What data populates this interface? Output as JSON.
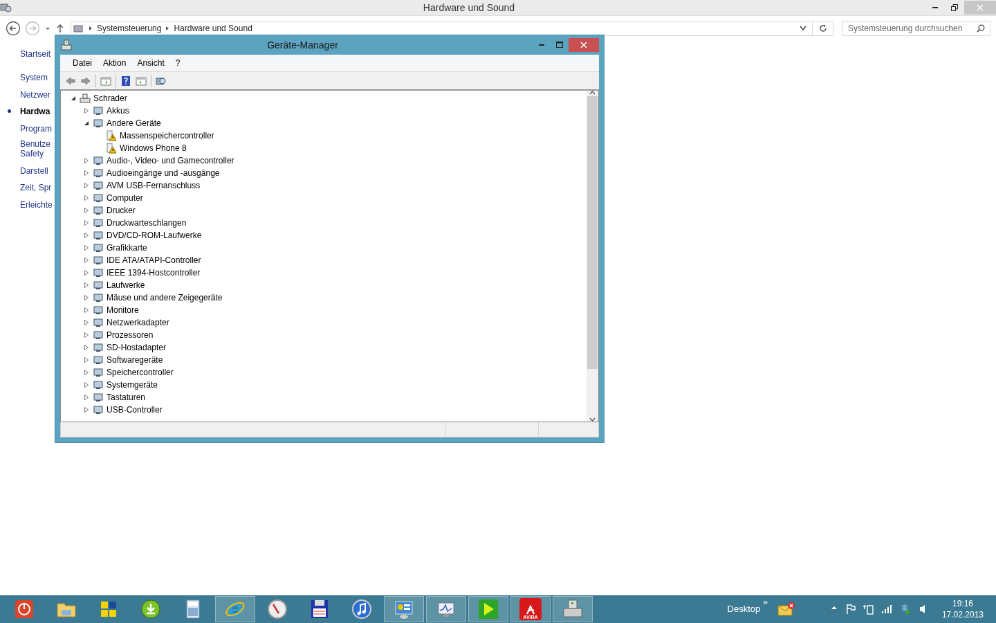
{
  "window": {
    "title": "Hardware und Sound"
  },
  "address": {
    "crumbs": [
      "Systemsteuerung",
      "Hardware und Sound"
    ]
  },
  "search": {
    "placeholder": "Systemsteuerung durchsuchen"
  },
  "sidebar": {
    "items": [
      {
        "lines": [
          "Startseit"
        ],
        "selected": false
      },
      {
        "lines": [
          "System"
        ],
        "selected": false
      },
      {
        "lines": [
          "Netzwer"
        ],
        "selected": false
      },
      {
        "lines": [
          "Hardwa"
        ],
        "selected": true
      },
      {
        "lines": [
          "Program"
        ],
        "selected": false
      },
      {
        "lines": [
          "Benutze",
          "Safety"
        ],
        "selected": false
      },
      {
        "lines": [
          "Darstell"
        ],
        "selected": false
      },
      {
        "lines": [
          "Zeit, Spr"
        ],
        "selected": false
      },
      {
        "lines": [
          "Erleichte"
        ],
        "selected": false
      }
    ]
  },
  "dialog": {
    "title": "Geräte-Manager",
    "menu": [
      "Datei",
      "Aktion",
      "Ansicht",
      "?"
    ],
    "tree": [
      {
        "label": "Schrader",
        "expanded": true,
        "children": [
          {
            "label": "Akkus",
            "expanded": false
          },
          {
            "label": "Andere Geräte",
            "expanded": true,
            "children": [
              {
                "label": "Massenspeichercontroller",
                "warning": true
              },
              {
                "label": "Windows Phone 8",
                "warning": true
              }
            ]
          },
          {
            "label": "Audio-, Video- und Gamecontroller",
            "expanded": false
          },
          {
            "label": "Audioeingänge und -ausgänge",
            "expanded": false
          },
          {
            "label": "AVM USB-Fernanschluss",
            "expanded": false
          },
          {
            "label": "Computer",
            "expanded": false
          },
          {
            "label": "Drucker",
            "expanded": false
          },
          {
            "label": "Druckwarteschlangen",
            "expanded": false
          },
          {
            "label": "DVD/CD-ROM-Laufwerke",
            "expanded": false
          },
          {
            "label": "Grafikkarte",
            "expanded": false
          },
          {
            "label": "IDE ATA/ATAPI-Controller",
            "expanded": false
          },
          {
            "label": "IEEE 1394-Hostcontroller",
            "expanded": false
          },
          {
            "label": "Laufwerke",
            "expanded": false
          },
          {
            "label": "Mäuse und andere Zeigegeräte",
            "expanded": false
          },
          {
            "label": "Monitore",
            "expanded": false
          },
          {
            "label": "Netzwerkadapter",
            "expanded": false
          },
          {
            "label": "Prozessoren",
            "expanded": false
          },
          {
            "label": "SD-Hostadapter",
            "expanded": false
          },
          {
            "label": "Softwaregeräte",
            "expanded": false
          },
          {
            "label": "Speichercontroller",
            "expanded": false
          },
          {
            "label": "Systemgeräte",
            "expanded": false
          },
          {
            "label": "Tastaturen",
            "expanded": false
          },
          {
            "label": "USB-Controller",
            "expanded": false
          }
        ]
      }
    ]
  },
  "taskbar": {
    "apps": [
      {
        "kind": "power",
        "active": false
      },
      {
        "kind": "explorer",
        "active": false
      },
      {
        "kind": "tiles",
        "active": false
      },
      {
        "kind": "download",
        "active": false
      },
      {
        "kind": "calculator",
        "active": false
      },
      {
        "kind": "browser",
        "active": true
      },
      {
        "kind": "gauge",
        "active": false
      },
      {
        "kind": "floppy",
        "active": false
      },
      {
        "kind": "music",
        "active": false
      },
      {
        "kind": "panel",
        "active": true
      },
      {
        "kind": "monitor",
        "active": true
      },
      {
        "kind": "play",
        "active": true
      },
      {
        "kind": "antivirus",
        "active": true,
        "label": "AVIRA"
      },
      {
        "kind": "devices",
        "active": true
      }
    ],
    "toolbar_label": "Desktop",
    "toolbar_more": "»",
    "time": "19:16",
    "date": "17.02.2013"
  }
}
